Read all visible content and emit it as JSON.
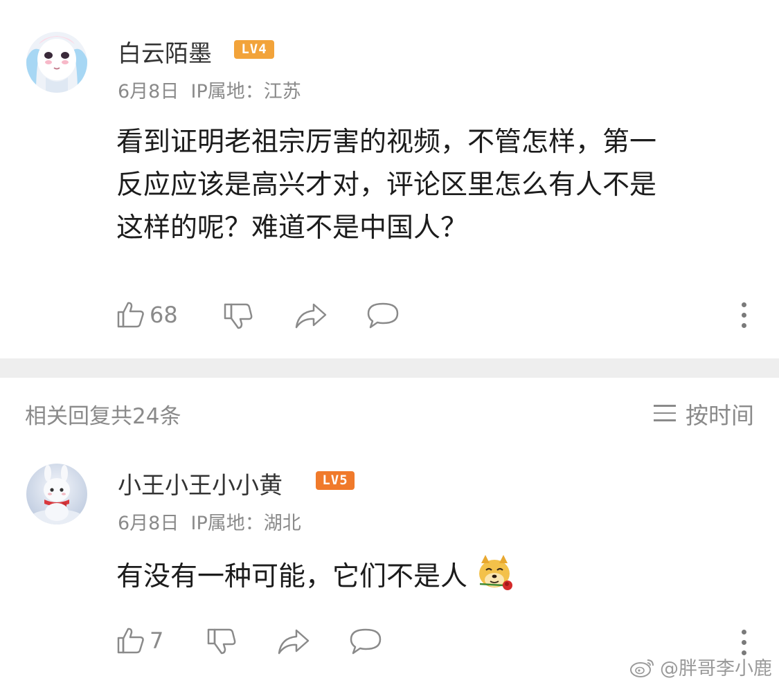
{
  "comment": {
    "username": "白云陌墨",
    "level": "LV4",
    "date": "6月8日",
    "ip_location": "IP属地：江苏",
    "text_lines": [
      "看到证明老祖宗厉害的视频，不管怎样，第一",
      "反应应该是高兴才对，评论区里怎么有人不是",
      "这样的呢？难道不是中国人？"
    ],
    "likes": "68"
  },
  "replies_header": {
    "count_label": "相关回复共24条",
    "sort_label": "按时间"
  },
  "reply": {
    "username": "小王小王小小黄",
    "level": "LV5",
    "date": "6月8日",
    "ip_location": "IP属地：湖北",
    "text": "有没有一种可能，它们不是人",
    "likes": "7"
  },
  "watermark": {
    "text": "@胖哥李小鹿"
  },
  "colors": {
    "level4": "#f2a33a",
    "level5": "#f07a2b",
    "meta_gray": "#8a8a8a",
    "divider": "#eeeeee"
  }
}
